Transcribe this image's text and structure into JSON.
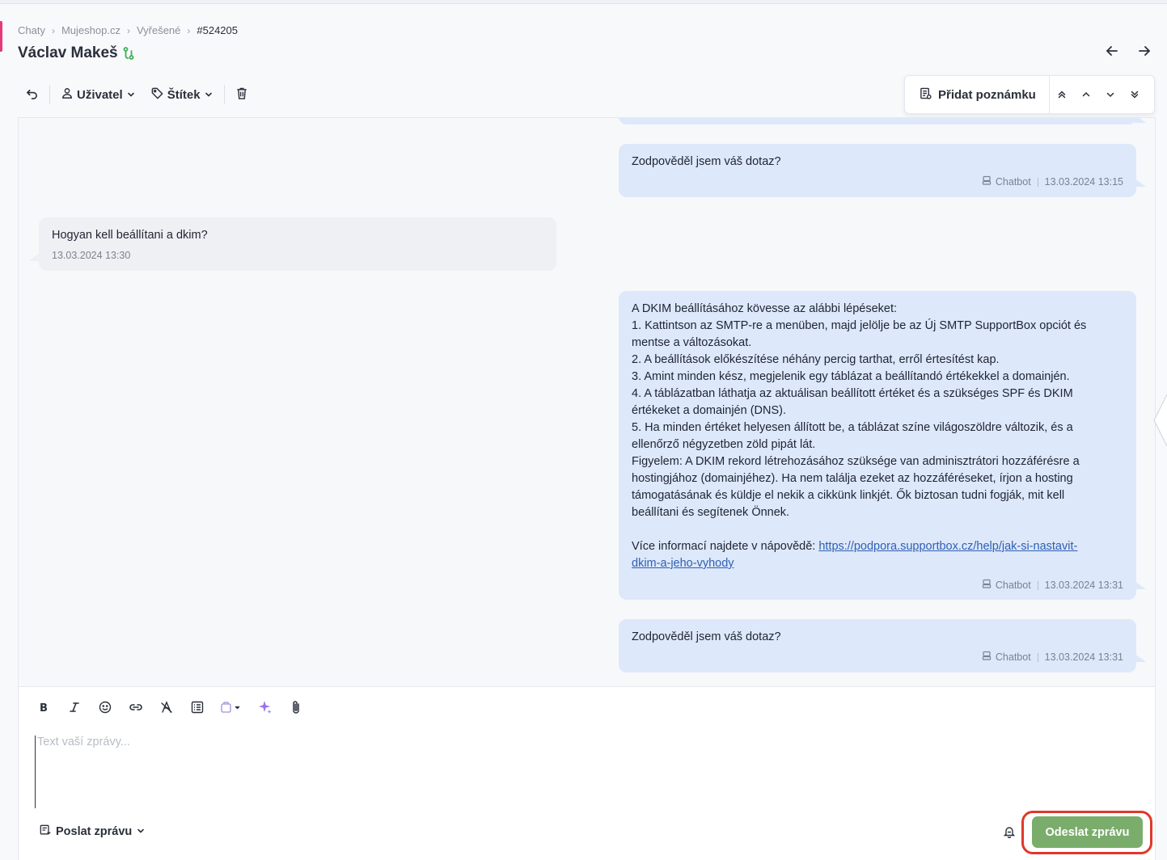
{
  "breadcrumb": {
    "items": [
      "Chaty",
      "Mujeshop.cz",
      "Vyřešené"
    ],
    "current": "#524205"
  },
  "conversation": {
    "title": "Václav Makeš"
  },
  "toolbar": {
    "user_label": "Uživatel",
    "tag_label": "Štítek"
  },
  "notes": {
    "add_note_label": "Přidat poznámku"
  },
  "messages": [
    {
      "direction": "out",
      "text": "Zodpověděl jsem váš dotaz?",
      "author": "Chatbot",
      "time": "13.03.2024 13:15"
    },
    {
      "direction": "in",
      "text": "Hogyan kell beállítani a dkim?",
      "time": "13.03.2024 13:30"
    },
    {
      "direction": "out",
      "lines": [
        "A DKIM beállításához kövesse az alábbi lépéseket:",
        "1. Kattintson az SMTP-re a menüben, majd jelölje be az Új SMTP SupportBox opciót és",
        "mentse a változásokat.",
        "2. A beállítások előkészítése néhány percig tarthat, erről értesítést kap.",
        "3. Amint minden kész, megjelenik egy táblázat a beállítandó értékekkel a domainjén.",
        "4. A táblázatban láthatja az aktuálisan beállított értéket és a szükséges SPF és DKIM",
        "értékeket a domainjén (DNS).",
        "5. Ha minden értéket helyesen állított be, a táblázat színe világoszöldre változik, és a",
        "ellenőrző négyzetben zöld pipát lát.",
        "Figyelem: A DKIM rekord létrehozásához szüksége van adminisztrátori hozzáférésre a",
        "hostingjához (domainjéhez). Ha nem találja ezeket az hozzáféréseket, írjon a hosting",
        "támogatásának és küldje el nekik a cikkünk linkjét. Ők biztosan tudni fogják, mit kell",
        "beállítani és segítenek Önnek."
      ],
      "more_info": "Více informací najdete v nápovědě: ",
      "link_line1": "https://podpora.supportbox.cz/help/jak-si-nastavit-",
      "link_line2": "dkim-a-jeho-vyhody",
      "author": "Chatbot",
      "time": "13.03.2024 13:31"
    },
    {
      "direction": "out",
      "text": "Zodpověděl jsem váš dotaz?",
      "author": "Chatbot",
      "time": "13.03.2024 13:31"
    }
  ],
  "composer": {
    "placeholder": "Text vaší zprávy...",
    "value": "",
    "send_mode_label": "Poslat zprávu",
    "send_button_label": "Odeslat zprávu"
  },
  "colors": {
    "accent_pink": "#e6397a",
    "send_green": "#7aad6b",
    "highlight_red": "#e0382b",
    "bubble_out": "#dde8fa",
    "bubble_in": "#eff0f3",
    "link": "#2f5fb3"
  },
  "icons": [
    "undo-icon",
    "user-icon",
    "tag-icon",
    "chevron-down-icon",
    "trash-icon",
    "arrow-left-icon",
    "arrow-right-icon",
    "note-icon",
    "double-chevron-up-icon",
    "chevron-up-icon",
    "double-chevron-down-icon",
    "bold-icon",
    "italic-icon",
    "emoji-icon",
    "link-icon",
    "clear-format-icon",
    "template-icon",
    "macro-icon",
    "ai-sparkle-icon",
    "paperclip-icon",
    "robot-icon",
    "bell-icon",
    "status-icon"
  ]
}
